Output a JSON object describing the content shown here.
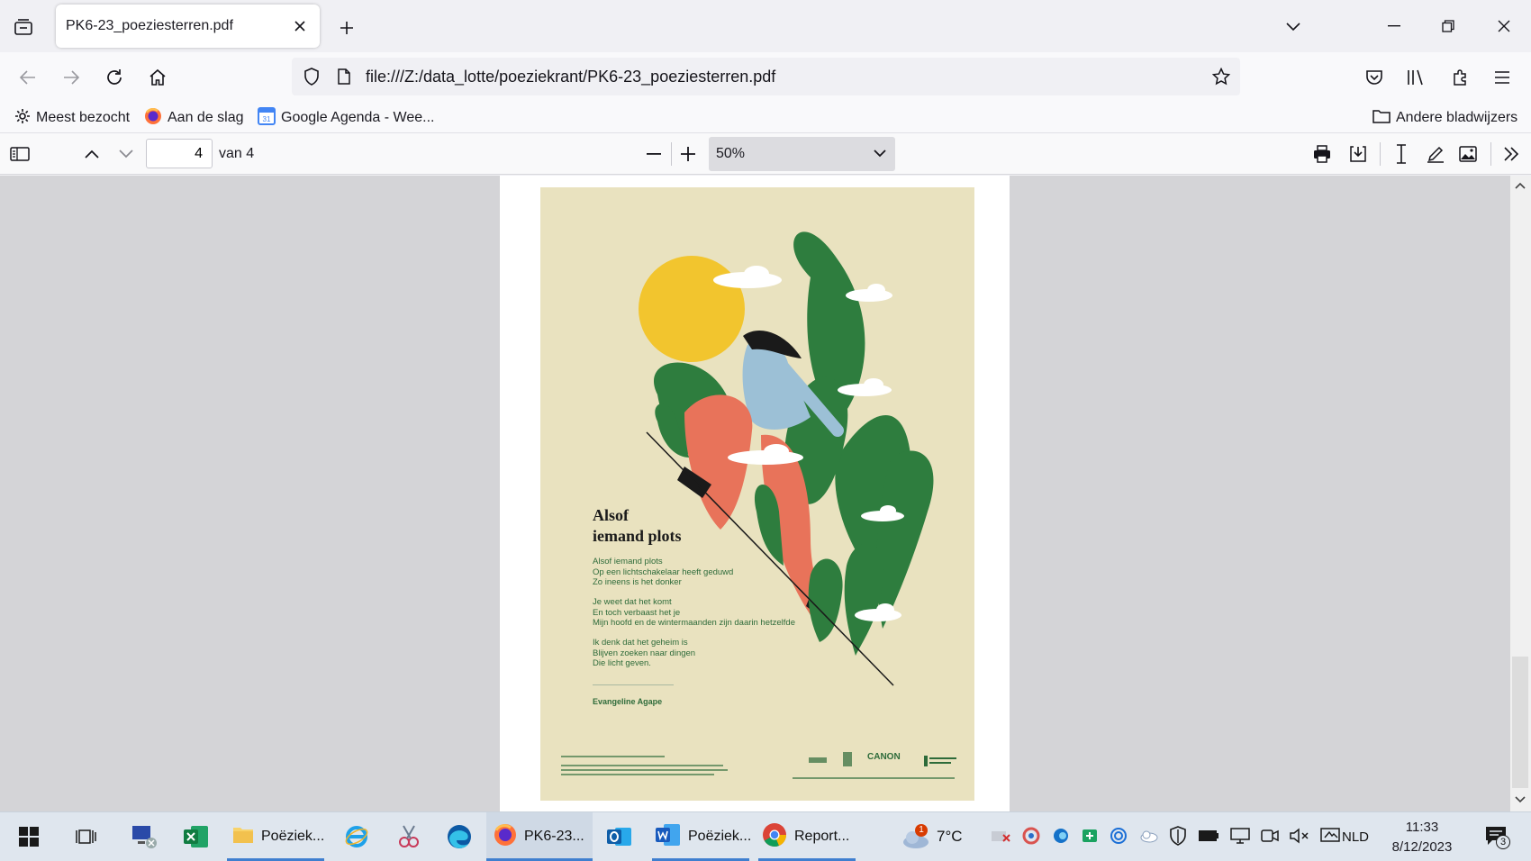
{
  "tab": {
    "title": "PK6-23_poeziesterren.pdf"
  },
  "navbar": {
    "url": "file:///Z:/data_lotte/poeziekrant/PK6-23_poeziesterren.pdf"
  },
  "bookmarks": [
    {
      "label": "Meest bezocht",
      "icon": "gear-icon"
    },
    {
      "label": "Aan de slag",
      "icon": "firefox-icon"
    },
    {
      "label": "Google Agenda - Wee...",
      "icon": "calendar-icon"
    }
  ],
  "bookmarks_other": "Andere bladwijzers",
  "pdf": {
    "page_current": "4",
    "page_of": "van 4",
    "zoom": "50%"
  },
  "poster": {
    "title": "Alsof\niemand plots",
    "stanzas": [
      "Alsof iemand plots\nOp een lichtschakelaar heeft geduwd\nZo ineens is het donker",
      "Je weet dat het komt\nEn toch verbaast het je\nMijn hoofd en de wintermaanden zijn daarin hetzelfde",
      "Ik denk dat het geheim is\nBlijven zoeken naar dingen\nDie licht geven."
    ],
    "author": "Evangeline Agape",
    "canon": "CANON",
    "colors": {
      "background": "#e9e2bf",
      "green": "#2e7d3e",
      "sun": "#f2c52e",
      "coral": "#e8735a",
      "blue": "#9cc0d6"
    }
  },
  "taskbar": {
    "explorer": "Poëziek...",
    "firefox": "PK6-23...",
    "word": "Poëziek...",
    "chrome": "Report...",
    "weather_temp": "7°C",
    "weather_badge": "1",
    "language": "NLD",
    "time": "11:33",
    "date": "8/12/2023",
    "notifications": "3"
  }
}
